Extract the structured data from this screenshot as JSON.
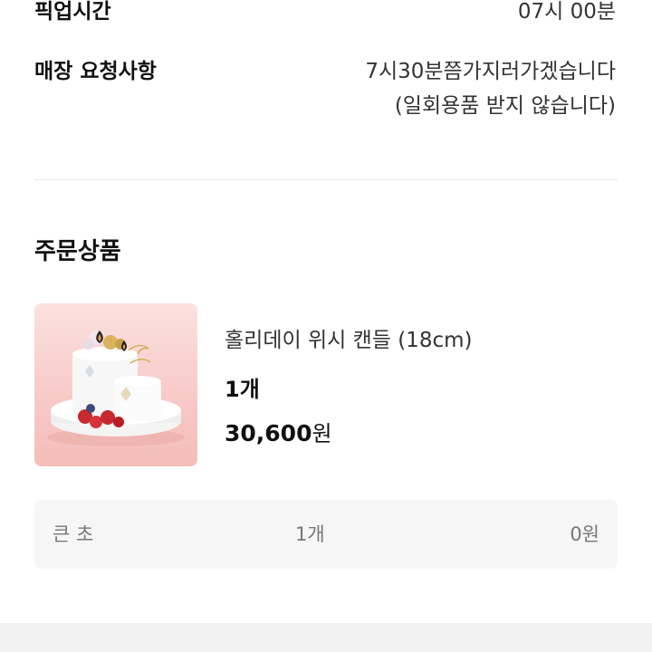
{
  "pickup": {
    "label": "픽업시간",
    "value": "07시 00분"
  },
  "store_request": {
    "label": "매장 요청사항",
    "line1": "7시30분쯤가지러가겠습니다",
    "line2": "(일회용품 받지 않습니다)"
  },
  "order_section": {
    "title": "주문상품"
  },
  "product": {
    "name": "홀리데이 위시 캔들 (18cm)",
    "quantity": "1개",
    "price_number": "30,600",
    "price_unit": "원",
    "image_icon": "cake-image"
  },
  "option": {
    "name": "큰 초",
    "quantity": "1개",
    "price": "0원"
  }
}
